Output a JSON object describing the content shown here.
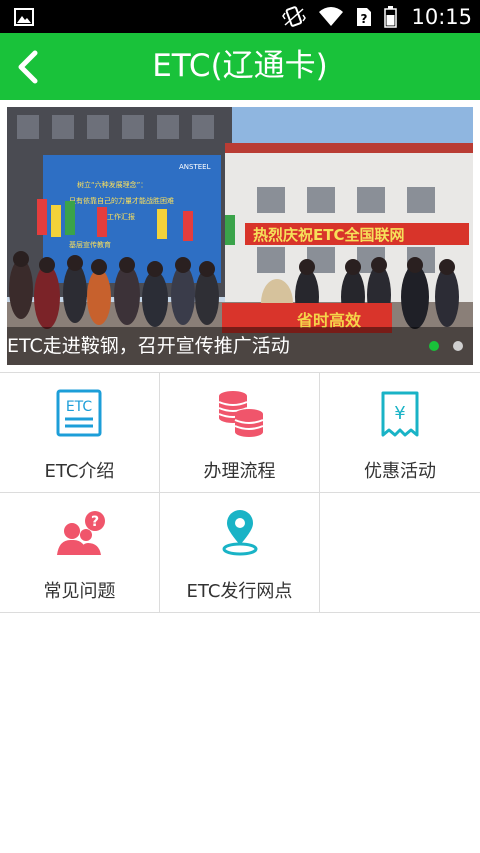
{
  "status_bar": {
    "time": "10:15",
    "icons": [
      "image-icon",
      "vibrate-icon",
      "wifi-icon",
      "no-sim-icon",
      "battery-icon"
    ]
  },
  "header": {
    "title": "ETC(辽通卡)",
    "back_icon": "chevron-left-icon",
    "color": "#19c23a"
  },
  "banner": {
    "caption": "ETC走进鞍钢，召开宣传推广活动",
    "slides_total": 2,
    "active_slide": 1,
    "photo_text": {
      "board_brand": "ANSTEEL",
      "board_line1": "树立“六种发展理念”：",
      "board_line2": "只有依靠自己的力量才能战胜困难",
      "board_line3": "工作汇报",
      "board_line4": "基层宣传教育",
      "red_banner": "热烈庆祝ETC全国联网",
      "table_banner": "省时高效"
    }
  },
  "grid": {
    "items": [
      {
        "label": "ETC介绍",
        "icon": "etc-card-icon"
      },
      {
        "label": "办理流程",
        "icon": "coin-stack-icon"
      },
      {
        "label": "优惠活动",
        "icon": "receipt-yen-icon"
      },
      {
        "label": "常见问题",
        "icon": "people-question-icon"
      },
      {
        "label": "ETC发行网点",
        "icon": "location-pin-icon"
      }
    ]
  },
  "colors": {
    "accent": "#19c23a",
    "icon_blue": "#1c9ed8",
    "icon_pink": "#f0556b",
    "icon_teal": "#19b3c6"
  }
}
